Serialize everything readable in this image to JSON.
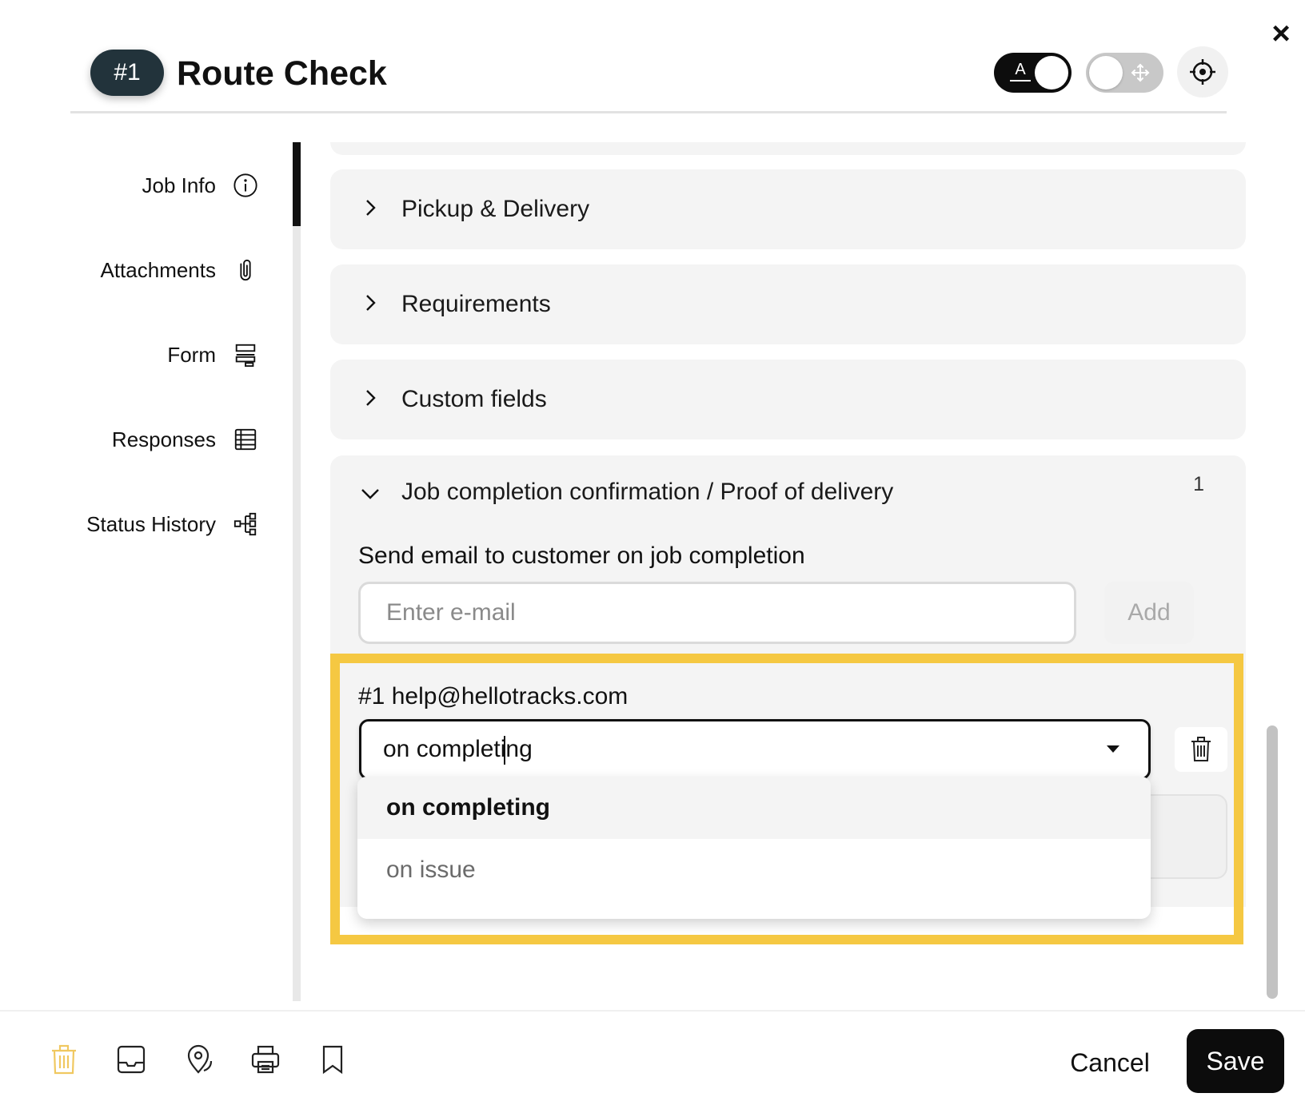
{
  "header": {
    "job_number": "#1",
    "job_title": "Route Check",
    "label_toggle_glyph": "A"
  },
  "sidenav": {
    "items": [
      {
        "label": "Job Info",
        "icon": "info-icon"
      },
      {
        "label": "Attachments",
        "icon": "paperclip-icon"
      },
      {
        "label": "Form",
        "icon": "form-icon"
      },
      {
        "label": "Responses",
        "icon": "table-icon"
      },
      {
        "label": "Status History",
        "icon": "hierarchy-icon"
      }
    ],
    "active": "Job Info"
  },
  "panels": [
    {
      "title": "Pickup & Delivery",
      "expanded": false
    },
    {
      "title": "Requirements",
      "expanded": false
    },
    {
      "title": "Custom fields",
      "expanded": false
    }
  ],
  "completion_panel": {
    "title": "Job completion confirmation / Proof of delivery",
    "count": "1",
    "send_label": "Send email to customer on job completion",
    "email_placeholder": "Enter e-mail",
    "add_label": "Add",
    "recipient": {
      "title": "#1 help@hellotracks.com",
      "trigger_value": "on completing"
    },
    "dropdown_options": [
      "on completing",
      "on issue"
    ]
  },
  "footer": {
    "cancel_label": "Cancel",
    "save_label": "Save"
  },
  "colors": {
    "highlight": "#f5c842",
    "badge_bg": "#22333b",
    "primary_button": "#0c0c0c",
    "delete_icon": "#f0c860"
  }
}
